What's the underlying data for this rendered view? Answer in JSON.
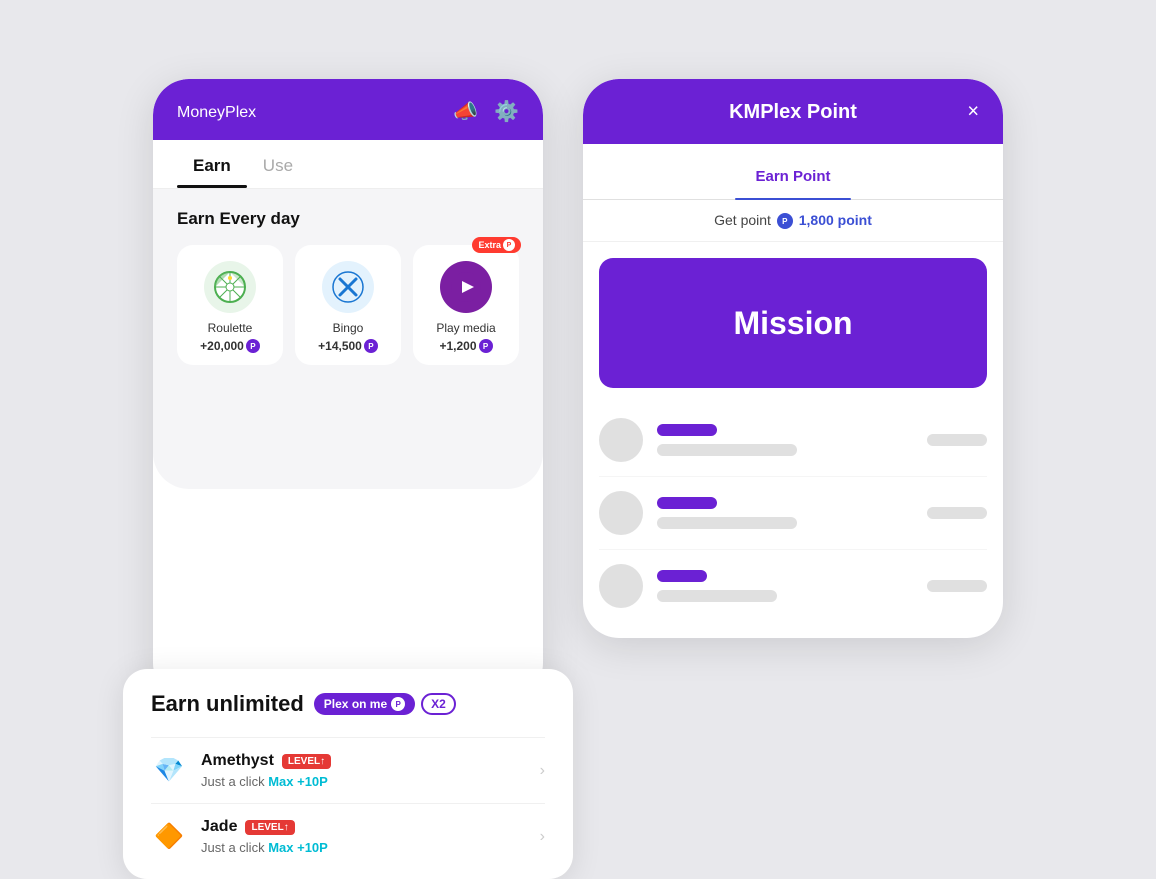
{
  "app": {
    "brand": "Money",
    "brand_suffix": "Plex",
    "tabs": [
      {
        "label": "Earn",
        "active": true
      },
      {
        "label": "Use",
        "active": false
      }
    ],
    "section_title": "Earn Every day",
    "activities": [
      {
        "id": "roulette",
        "label": "Roulette",
        "points": "+20,000",
        "extra": false
      },
      {
        "id": "bingo",
        "label": "Bingo",
        "points": "+14,500",
        "extra": false
      },
      {
        "id": "media",
        "label": "Play media",
        "points": "+1,200",
        "extra": true,
        "extra_label": "Extra"
      }
    ],
    "earn_unlimited": {
      "title": "Earn unlimited",
      "plex_badge": "Plex on me",
      "x2": "X2",
      "items": [
        {
          "name": "Amethyst",
          "level_label": "LEVEL↑",
          "desc_prefix": "Just a click",
          "desc_max": "Max +10P"
        },
        {
          "name": "Jade",
          "level_label": "LEVEL↑",
          "desc_prefix": "Just a click",
          "desc_max": "Max +10P"
        }
      ]
    }
  },
  "modal": {
    "title": "KMPlex Point",
    "close_label": "×",
    "tab_label": "Earn Point",
    "points_prefix": "Get point",
    "points_value": "1,800 point",
    "mission_label": "Mission",
    "skeleton_rows": 3
  }
}
